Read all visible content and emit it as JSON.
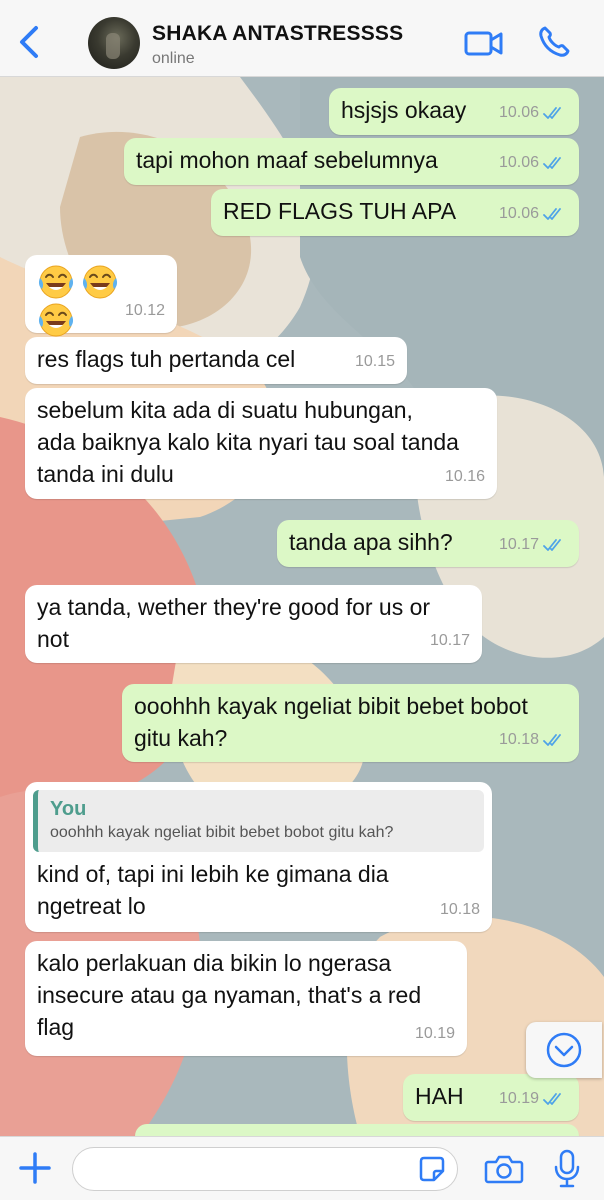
{
  "header": {
    "back_icon": "chevron-left-icon",
    "contact_name": "SHAKA ANTASTRESSSS",
    "status": "online",
    "video_icon": "video-call-icon",
    "call_icon": "phone-call-icon",
    "accent_color": "#2f7cf6"
  },
  "colors": {
    "outgoing_bubble": "#dcf8c6",
    "incoming_bubble": "#ffffff",
    "read_ticks": "#4fa3e8",
    "reply_accent": "#4e9d8d"
  },
  "messages": [
    {
      "dir": "out",
      "text": "hsjsjs okaay",
      "time": "10.06",
      "read": true
    },
    {
      "dir": "out",
      "text": "tapi mohon maaf sebelumnya",
      "time": "10.06",
      "read": true
    },
    {
      "dir": "out",
      "text": "RED FLAGS TUH APA",
      "time": "10.06",
      "read": true
    },
    {
      "dir": "in",
      "text": "",
      "emojis": [
        "face-with-tears-of-joy",
        "face-with-tears-of-joy",
        "face-with-tears-of-joy"
      ],
      "time": "10.12"
    },
    {
      "dir": "in",
      "text": "res flags tuh pertanda cel",
      "time": "10.15"
    },
    {
      "dir": "in",
      "text": "sebelum kita ada di suatu hubungan,\nada baiknya kalo kita nyari tau soal tanda\ntanda ini dulu",
      "time": "10.16"
    },
    {
      "dir": "out",
      "text": "tanda apa sihh?",
      "time": "10.17",
      "read": true
    },
    {
      "dir": "in",
      "text": "ya tanda, wether they're good for us or\nnot",
      "time": "10.17"
    },
    {
      "dir": "out",
      "text": "ooohhh kayak ngeliat bibit bebet bobot\ngitu kah?",
      "time": "10.18",
      "read": true
    },
    {
      "dir": "in",
      "reply_to": {
        "author": "You",
        "text": "ooohhh kayak ngeliat bibit bebet bobot gitu kah?"
      },
      "text": "kind of, tapi ini lebih ke gimana dia\nngetreat lo",
      "time": "10.18"
    },
    {
      "dir": "in",
      "text": "kalo perlakuan dia bikin lo ngerasa\ninsecure atau ga nyaman, that's a red\nflag",
      "time": "10.19"
    },
    {
      "dir": "out",
      "text": "HAH",
      "time": "10.19",
      "read": true
    }
  ],
  "scroll_button_icon": "chevron-down-circle-icon",
  "composer": {
    "plus_icon": "plus-icon",
    "input_value": "",
    "input_placeholder": "",
    "sticker_icon": "sticker-icon",
    "camera_icon": "camera-icon",
    "mic_icon": "microphone-icon"
  }
}
